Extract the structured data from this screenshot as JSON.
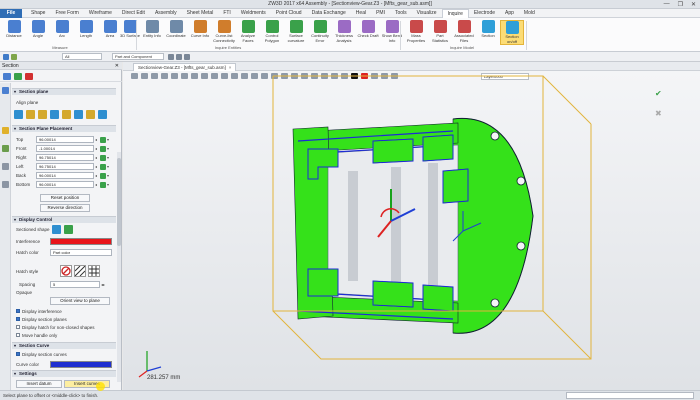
{
  "window": {
    "title": "ZW3D 2017  x64          Assembly   - [Sectionview-Gear.Z3 - [Mfts_gear_sub.asm]]",
    "controls": [
      "—",
      "❐",
      "✕"
    ]
  },
  "menu": {
    "file": "File",
    "tabs": [
      "Shape",
      "Free Form",
      "Wireframe",
      "Direct Edit",
      "Assembly",
      "Sheet Metal",
      "FTI",
      "Weldments",
      "Point Cloud",
      "Data Exchange",
      "Heal",
      "PMI",
      "Tools",
      "Visualize",
      "Inquire",
      "Electrode",
      "App",
      "Mold"
    ],
    "active_tab": "Inquire"
  },
  "ribbon": {
    "buttons": [
      {
        "label": "Distance",
        "color": "#4a7fd0"
      },
      {
        "label": "Angle",
        "color": "#4a7fd0"
      },
      {
        "label": "Arc",
        "color": "#4a7fd0"
      },
      {
        "label": "Length",
        "color": "#4a7fd0"
      },
      {
        "label": "Area",
        "color": "#4a7fd0"
      },
      {
        "label": "3D Surface",
        "color": "#4a7fd0"
      },
      {
        "label": "Entity Info",
        "color": "#6f8aa8"
      },
      {
        "label": "Coordinate",
        "color": "#6f8aa8"
      },
      {
        "label": "Curve Info",
        "color": "#d07d2c"
      },
      {
        "label": "Curve-list Connectivity",
        "color": "#d07d2c"
      },
      {
        "label": "Analyze Faces",
        "color": "#3aa14a"
      },
      {
        "label": "Control Polygon",
        "color": "#3aa14a"
      },
      {
        "label": "Surface curvature",
        "color": "#3aa14a"
      },
      {
        "label": "Continuity Error",
        "color": "#3aa14a"
      },
      {
        "label": "Thickness Analysis",
        "color": "#9b6bc4"
      },
      {
        "label": "Check Draft",
        "color": "#9b6bc4"
      },
      {
        "label": "Show Bend Info",
        "color": "#9b6bc4"
      },
      {
        "label": "Mass Properties",
        "color": "#c94a4a"
      },
      {
        "label": "Part Statistics",
        "color": "#c94a4a"
      },
      {
        "label": "Associated Files",
        "color": "#c94a4a"
      },
      {
        "label": "Section",
        "color": "#2f9fd8"
      },
      {
        "label": "Section on/off",
        "color": "#2f9fd8"
      }
    ],
    "groups": [
      "Measure",
      "Inquire Entities",
      "Inquire Model"
    ]
  },
  "quickbar": {
    "filter": "All",
    "mode": "Part and Component"
  },
  "panel": {
    "title": "Section",
    "close": "✕",
    "section_plane": {
      "header": "Section plane",
      "align_label": "Align plane"
    },
    "placement": {
      "header": "Section Plane Placement",
      "rows": [
        {
          "label": "Top",
          "value": "96.00014"
        },
        {
          "label": "Front",
          "value": "-1.00014"
        },
        {
          "label": "Right",
          "value": "96.75014"
        },
        {
          "label": "Left",
          "value": "96.75014"
        },
        {
          "label": "Back",
          "value": "96.00014"
        },
        {
          "label": "Bottom",
          "value": "96.00014"
        }
      ],
      "reset_button": "Reset position",
      "reverse_button": "Reverse direction"
    },
    "display_control": {
      "header": "Display Control",
      "sectioned_shape_label": "Sectioned shape",
      "interference_label": "Interference",
      "interference_color": "#e8141a",
      "hatch_color_label": "Hatch color",
      "hatch_color_value": "Part color",
      "hatch_style_label": "Hatch style",
      "spacing_label": "Spacing",
      "spacing_value": "5",
      "opaque_label": "Opaque",
      "orient_button": "Orient view to plane",
      "checkboxes": [
        {
          "label": "Display interference",
          "checked": true
        },
        {
          "label": "Display section planes",
          "checked": true
        },
        {
          "label": "Display hatch for non-closed shapes",
          "checked": false
        },
        {
          "label": "Move handle only",
          "checked": false
        }
      ]
    },
    "section_curve": {
      "header": "Section Curve",
      "display_label": "Display section curves",
      "display_checked": true,
      "curve_color_label": "Curve color",
      "curve_color": "#1f2fd0"
    },
    "settings": {
      "header": "Settings",
      "insert_datum": "Insert datum",
      "insert_curves": "Insert curves"
    }
  },
  "document": {
    "tab": "Sectionview-Gear.Z3 - [Mfts_gear_sub.asm]",
    "layer": "Layer0000"
  },
  "viewport": {
    "coordinate": "281.257 mm",
    "part_color": "#35e11a",
    "section_color": "#1d2bd6",
    "bbox_color": "#e2b43c"
  },
  "status": {
    "message": "Select plane to offset or <middle-click> to finish."
  }
}
